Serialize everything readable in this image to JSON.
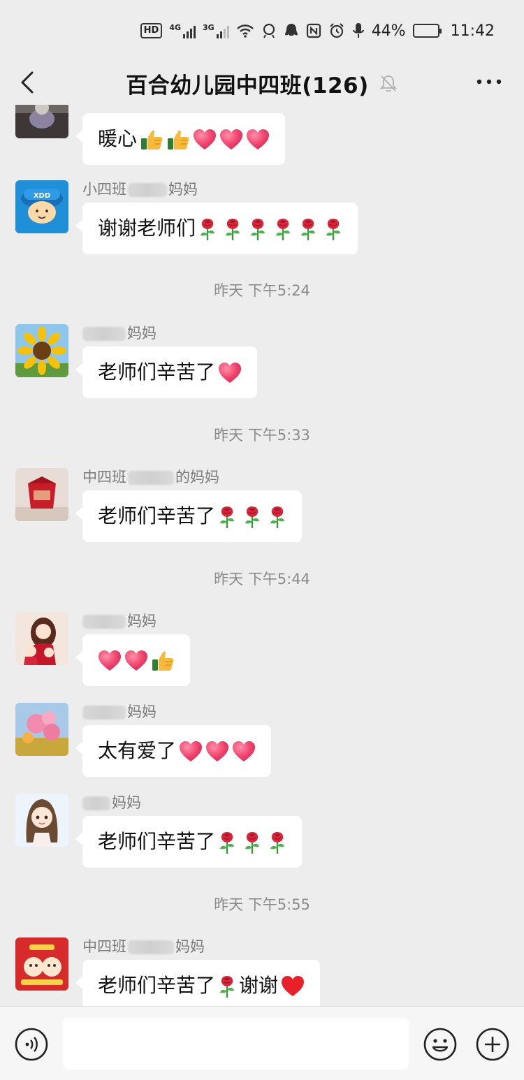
{
  "status_bar": {
    "hd_label": "HD",
    "network_1": "4G",
    "network_2": "3G",
    "battery_percent": "44%",
    "battery_level": 0.44,
    "time": "11:42"
  },
  "header": {
    "title": "百合幼儿园中四班(126)",
    "icons": [
      "back-chevron-icon",
      "mute-bell-icon",
      "more-dots-icon"
    ]
  },
  "messages": [
    {
      "sender": "",
      "text": "暖心",
      "emoji": [
        "thumbs-up",
        "thumbs-up",
        "heart",
        "heart",
        "heart"
      ]
    },
    {
      "sender_prefix": "小四班",
      "sender_suffix": "妈妈",
      "text": "谢谢老师们",
      "emoji": [
        "rose",
        "rose",
        "rose",
        "rose",
        "rose",
        "rose"
      ]
    },
    {
      "sender_prefix": "",
      "sender_suffix": "妈妈",
      "text": "老师们辛苦了",
      "emoji": [
        "heart"
      ]
    },
    {
      "sender_prefix": "中四班",
      "sender_suffix": "的妈妈",
      "text": "老师们辛苦了",
      "emoji": [
        "rose",
        "rose",
        "rose"
      ]
    },
    {
      "sender_prefix": "",
      "sender_suffix": "妈妈",
      "text": "",
      "emoji": [
        "heart",
        "heart",
        "thumbs-up"
      ]
    },
    {
      "sender_prefix": "",
      "sender_suffix": "妈妈",
      "text": "太有爱了",
      "emoji": [
        "heart",
        "heart",
        "heart"
      ]
    },
    {
      "sender_prefix": "",
      "sender_suffix": "妈妈",
      "text": "老师们辛苦了",
      "emoji": [
        "rose",
        "rose",
        "rose"
      ]
    },
    {
      "sender_prefix": "中四班",
      "sender_suffix": "妈妈",
      "text": "老师们辛苦了",
      "text_after": "谢谢",
      "emoji": [
        "rose",
        "red-heart"
      ]
    }
  ],
  "timestamps": [
    "昨天 下午5:24",
    "昨天 下午5:33",
    "昨天 下午5:44",
    "昨天 下午5:55"
  ],
  "input_bar": {
    "placeholder": "",
    "icons": [
      "voice-icon",
      "emoji-icon",
      "plus-icon"
    ]
  },
  "colors": {
    "background": "#ededed",
    "bubble": "#ffffff",
    "heart": "#f0456e",
    "rose": "#d8263a",
    "thumb": "#f6b93b"
  }
}
